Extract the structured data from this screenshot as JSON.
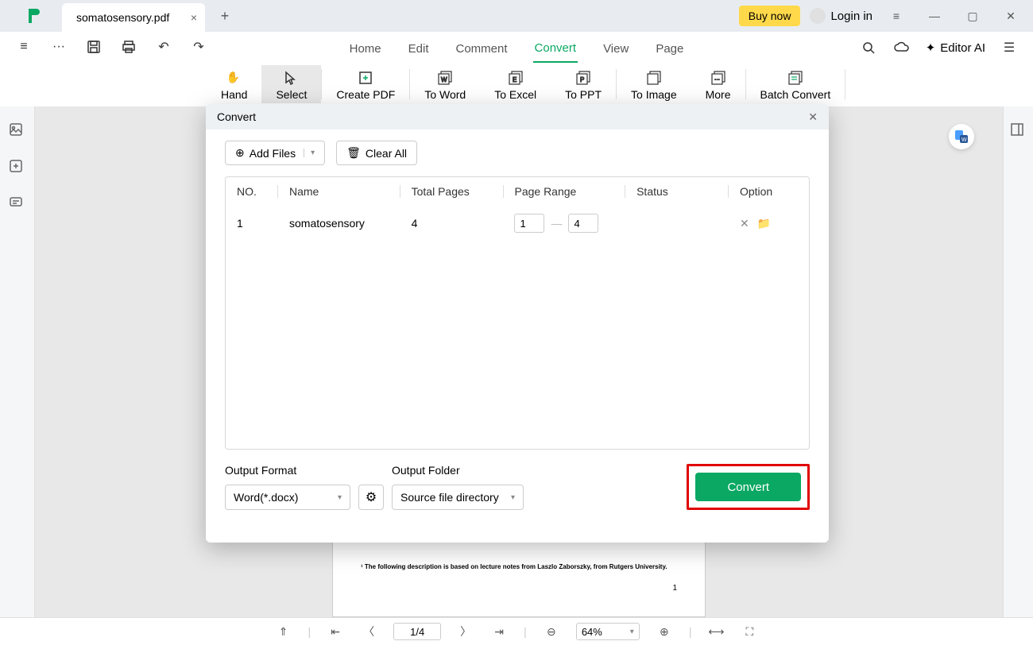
{
  "titlebar": {
    "tab_name": "somatosensory.pdf",
    "buy_now": "Buy now",
    "login": "Login in"
  },
  "menu": {
    "home": "Home",
    "edit": "Edit",
    "comment": "Comment",
    "convert": "Convert",
    "view": "View",
    "page": "Page",
    "editor_ai": "Editor AI"
  },
  "ribbon": {
    "hand": "Hand",
    "select": "Select",
    "create_pdf": "Create PDF",
    "to_word": "To Word",
    "to_excel": "To Excel",
    "to_ppt": "To PPT",
    "to_image": "To Image",
    "more": "More",
    "batch_convert": "Batch Convert"
  },
  "modal": {
    "title": "Convert",
    "add_files": "Add Files",
    "clear_all": "Clear All",
    "headers": {
      "no": "NO.",
      "name": "Name",
      "total_pages": "Total Pages",
      "page_range": "Page Range",
      "status": "Status",
      "option": "Option"
    },
    "files": [
      {
        "no": "1",
        "name": "somatosensory",
        "total_pages": "4",
        "range_from": "1",
        "range_to": "4",
        "status": ""
      }
    ],
    "output_format_label": "Output Format",
    "output_format_value": "Word(*.docx)",
    "output_folder_label": "Output Folder",
    "output_folder_value": "Source file directory",
    "convert_btn": "Convert"
  },
  "document": {
    "footnote": "¹ The following description is based on lecture notes from Laszlo Zaborszky, from Rutgers University.",
    "page_num": "1"
  },
  "statusbar": {
    "page": "1/4",
    "zoom": "64%"
  }
}
